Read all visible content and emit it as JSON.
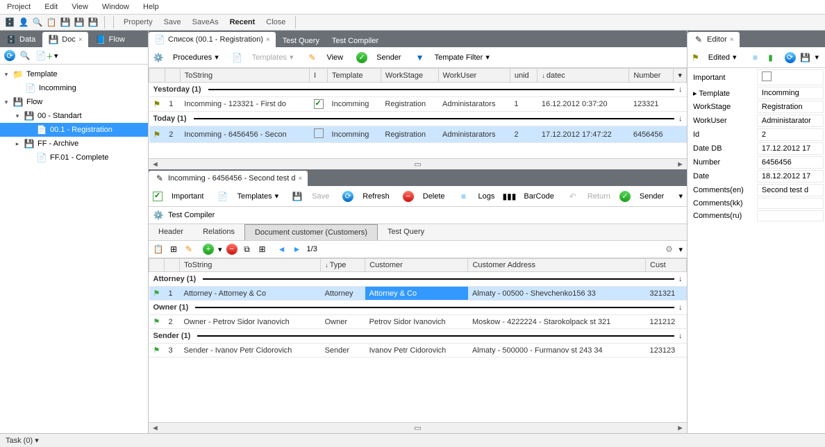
{
  "menu": {
    "project": "Project",
    "edit": "Edit",
    "view": "View",
    "window": "Window",
    "help": "Help"
  },
  "toolbar1": {
    "property": "Property",
    "save": "Save",
    "saveas": "SaveAs",
    "recent": "Recent",
    "close": "Close"
  },
  "left": {
    "tabs": {
      "data": "Data",
      "doc": "Doc",
      "flow": "Flow"
    },
    "tree": {
      "template": "Template",
      "incomming": "Incomming",
      "flow": "Flow",
      "standart": "00 - Standart",
      "registration": "00.1 - Registration",
      "archive": "FF - Archive",
      "complete": "FF.01 - Complete"
    }
  },
  "center": {
    "tabs": {
      "list": "Список (00.1 - Registration)",
      "testquery": "Test Query",
      "testcompiler": "Test Compiler"
    },
    "tb": {
      "procedures": "Procedures",
      "templates": "Templates",
      "view": "View",
      "sender": "Sender",
      "tfilter": "Tempate Filter"
    },
    "cols": {
      "tostring": "ToString",
      "i": "I",
      "template": "Template",
      "workstage": "WorkStage",
      "workuser": "WorkUser",
      "unid": "unid",
      "datec": "datec",
      "number": "Number"
    },
    "groups": {
      "yesterday": "Yestorday (1)",
      "today": "Today (1)"
    },
    "rows": [
      {
        "n": "1",
        "s": "Incomming - 123321 - First do",
        "i": true,
        "tpl": "Incomming",
        "ws": "Registration",
        "wu": "Administarators",
        "unid": "1",
        "dc": "16.12.2012 0:37:20",
        "num": "123321"
      },
      {
        "n": "2",
        "s": "Incomming - 6456456 - Secon",
        "i": false,
        "tpl": "Incomming",
        "ws": "Registration",
        "wu": "Administarators",
        "unid": "2",
        "dc": "17.12.2012 17:47:22",
        "num": "6456456"
      }
    ],
    "detail": {
      "tab": "Incomming - 6456456 - Second test d",
      "tb": {
        "important": "Important",
        "templates": "Templates",
        "save": "Save",
        "refresh": "Refresh",
        "delete": "Delete",
        "logs": "Logs",
        "barcode": "BarCode",
        "return": "Return",
        "sender": "Sender"
      },
      "compiler": "Test Compiler",
      "subtabs": {
        "header": "Header",
        "relations": "Relations",
        "customers": "Document customer (Customers)",
        "testquery": "Test Query"
      },
      "pager": "1/3",
      "cols": {
        "tostring": "ToString",
        "type": "Type",
        "customer": "Customer",
        "addr": "Customer Address",
        "cust": "Cust"
      },
      "groups": {
        "attorney": "Attorney (1)",
        "owner": "Owner (1)",
        "sender": "Sender (1)"
      },
      "rows": [
        {
          "n": "1",
          "s": "Attorney - Attorney & Co",
          "type": "Attorney",
          "cust": "Attorney & Co",
          "addr": "Almaty - 00500 - Shevchenko156 33",
          "code": "321321"
        },
        {
          "n": "2",
          "s": "Owner - Petrov Sidor Ivanovich",
          "type": "Owner",
          "cust": "Petrov Sidor Ivanovich",
          "addr": "Moskow - 4222224 - Starokolpack st 321",
          "code": "121212"
        },
        {
          "n": "3",
          "s": "Sender - Ivanov Petr Cidorovich",
          "type": "Sender",
          "cust": "Ivanov Petr Cidorovich",
          "addr": "Almaty - 500000 - Furmanov st 243 34",
          "code": "123123"
        }
      ]
    }
  },
  "editor": {
    "title": "Editor",
    "edited": "Edited",
    "props": {
      "important_l": "Important",
      "template_l": "Template",
      "template_v": "Incomming",
      "workstage_l": "WorkStage",
      "workstage_v": "Registration",
      "workuser_l": "WorkUser",
      "workuser_v": "Administarator",
      "id_l": "Id",
      "id_v": "2",
      "datedb_l": "Date DB",
      "datedb_v": "17.12.2012 17",
      "number_l": "Number",
      "number_v": "6456456",
      "date_l": "Date",
      "date_v": "18.12.2012 17",
      "cen_l": "Comments(en)",
      "cen_v": "Second test d",
      "ckk_l": "Comments(kk)",
      "ckk_v": "",
      "cru_l": "Comments(ru)",
      "cru_v": ""
    }
  },
  "status": {
    "task": "Task (0)"
  }
}
